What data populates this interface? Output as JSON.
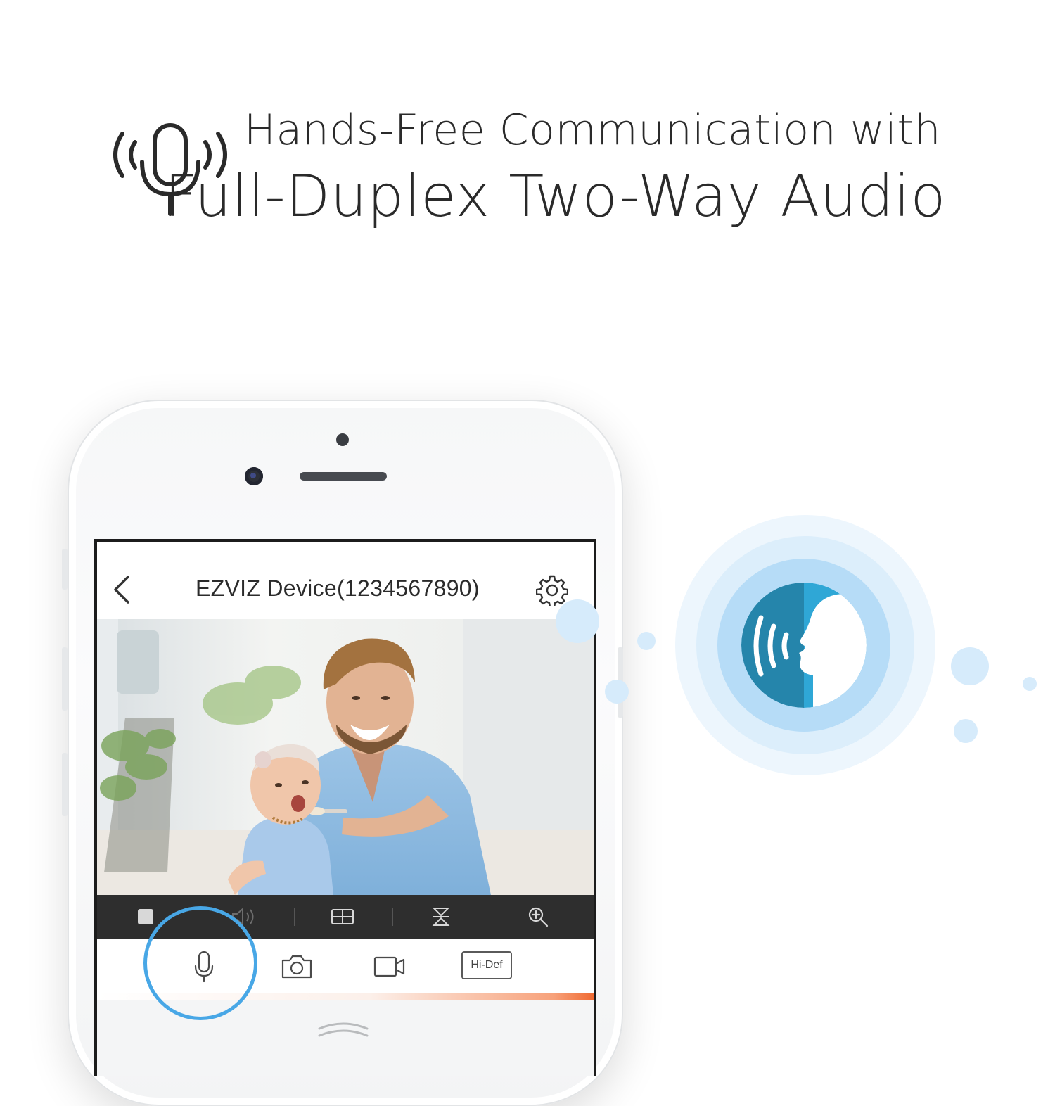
{
  "headline": {
    "line1": "Hands-Free Communication with",
    "line2": "Full-Duplex Two-Way Audio"
  },
  "app": {
    "device_title": "EZVIZ Device(1234567890)",
    "controls": {
      "stop_icon": "stop-icon",
      "volume_icon": "volume-icon",
      "split_view_icon": "split-view-icon",
      "ptz_icon": "ptz-icon",
      "zoom_icon": "zoom-icon"
    },
    "actions": {
      "talk_icon": "microphone-icon",
      "snapshot_icon": "camera-icon",
      "record_icon": "video-camera-icon",
      "quality_label": "Hi-Def"
    }
  },
  "colors": {
    "accent_blue": "#48a7e6",
    "talk_badge": "#2a9cc8",
    "recording_orange": "#f06a32",
    "text_dark": "#2a2a2a"
  }
}
